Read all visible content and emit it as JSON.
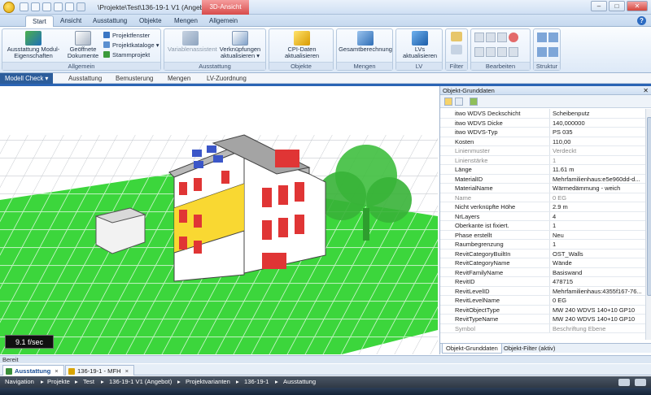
{
  "window": {
    "title": "\\Projekte\\Test\\136-19-1 V1 (Angebot) - iTWO",
    "context_tab": "3D-Ansicht",
    "min_label": "–",
    "max_label": "□",
    "close_label": "✕"
  },
  "ribbon_tabs": [
    "Start",
    "Ansicht",
    "Ausstattung",
    "Objekte",
    "Mengen",
    "Allgemein"
  ],
  "ribbon": {
    "groups": {
      "allgemein": "Allgemein",
      "ausstattung": "Ausstattung",
      "objekte": "Objekte",
      "mengen": "Mengen",
      "lv": "LV",
      "filter": "Filter",
      "bearbeiten": "Bearbeiten",
      "struktur": "Struktur"
    },
    "buttons": {
      "ausstattung_modul": "Ausstattung Modul-Eigenschaften",
      "geoeffnete": "Geöffnete Dokumente",
      "projektfenster": "Projektfenster",
      "projektkataloge": "Projektkataloge ▾",
      "stammprojekt": "Stammprojekt",
      "variablenassistent": "Variablenassistent",
      "verknuepfungen": "Verknüpfungen aktualisieren ▾",
      "cpi": "CPI-Daten aktualisieren",
      "gesamt": "Gesamtberechnung",
      "lvs": "LVs aktualisieren"
    }
  },
  "breadcrumb": [
    "Modell Check",
    "Ausstattung",
    "Bemusterung",
    "Mengen",
    "LV-Zuordnung"
  ],
  "viewport": {
    "fps": "9.1 f/sec"
  },
  "panel": {
    "title": "Objekt-Grunddaten",
    "close": "✕",
    "rows": [
      {
        "k": "itwo WDVS Deckschicht",
        "v": "Scheibenputz",
        "gray": false
      },
      {
        "k": "itwo WDVS Dicke",
        "v": "140,000000",
        "gray": false
      },
      {
        "k": "itwo WDVS-Typ",
        "v": "PS 035",
        "gray": false
      },
      {
        "k": "Kosten",
        "v": "110,00",
        "gray": false
      },
      {
        "k": "Linienmuster",
        "v": "Verdeckt",
        "gray": true
      },
      {
        "k": "Linienstärke",
        "v": "1",
        "gray": true
      },
      {
        "k": "Länge",
        "v": "11.61 m",
        "gray": false
      },
      {
        "k": "MaterialID",
        "v": "Mehrfamilienhaus:e5e960dd-d...",
        "gray": false
      },
      {
        "k": "MaterialName",
        "v": "Wärmedämmung - weich",
        "gray": false
      },
      {
        "k": "Name",
        "v": "0 EG",
        "gray": true
      },
      {
        "k": "Nicht verknüpfte Höhe",
        "v": "2.9 m",
        "gray": false
      },
      {
        "k": "NrLayers",
        "v": "4",
        "gray": false
      },
      {
        "k": "Oberkante ist fixiert.",
        "v": "1",
        "gray": false
      },
      {
        "k": "Phase erstellt",
        "v": "Neu",
        "gray": false
      },
      {
        "k": "Raumbegrenzung",
        "v": "1",
        "gray": false
      },
      {
        "k": "RevitCategoryBuiltIn",
        "v": "OST_Walls",
        "gray": false
      },
      {
        "k": "RevitCategoryName",
        "v": "Wände",
        "gray": false
      },
      {
        "k": "RevitFamilyName",
        "v": "Basiswand",
        "gray": false
      },
      {
        "k": "RevitID",
        "v": "478715",
        "gray": false
      },
      {
        "k": "RevitLevelID",
        "v": "Mehrfamilienhaus:4355f167-76...",
        "gray": false
      },
      {
        "k": "RevitLevelName",
        "v": "0 EG",
        "gray": false
      },
      {
        "k": "RevitObjectType",
        "v": "MW 240 WDVS 140+10 GP10",
        "gray": false
      },
      {
        "k": "RevitTypeName",
        "v": "MW 240 WDVS 140+10 GP10",
        "gray": false
      },
      {
        "k": "Symbol",
        "v": "Beschriftung Ebene",
        "gray": true
      }
    ],
    "tabs": [
      "Objekt-Grunddaten",
      "Objekt-Filter (aktiv)"
    ]
  },
  "status": "Bereit",
  "doc_tabs": [
    {
      "label": "Ausstattung",
      "close": "×"
    },
    {
      "label": "136-19-1 - MFH",
      "close": "×"
    }
  ],
  "nav": [
    "Navigation",
    "Projekte",
    "Test",
    "136-19-1 V1 (Angebot)",
    "Projektvarianten",
    "136-19-1",
    "Ausstattung"
  ],
  "nav_sep": "▸"
}
